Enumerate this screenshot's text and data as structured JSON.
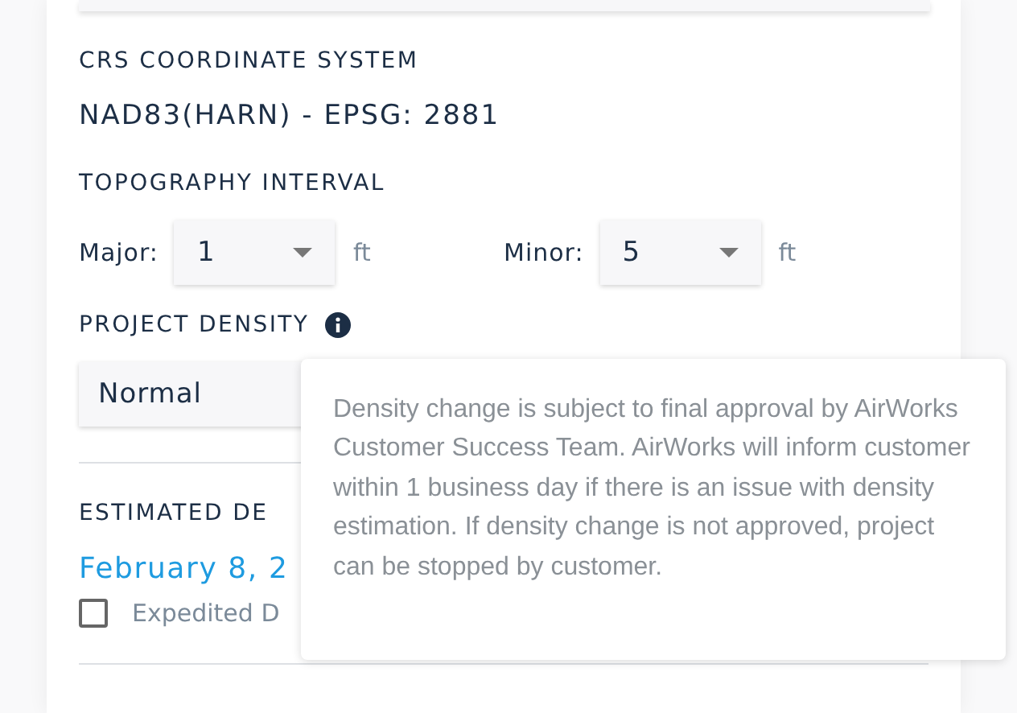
{
  "crs": {
    "label": "CRS COORDINATE SYSTEM",
    "value": "NAD83(HARN) - EPSG: 2881"
  },
  "topography": {
    "label": "TOPOGRAPHY INTERVAL",
    "fields": [
      {
        "label": "Major:",
        "value": "1",
        "unit": "ft"
      },
      {
        "label": "Minor:",
        "value": "5",
        "unit": "ft"
      }
    ]
  },
  "density": {
    "label": "PROJECT DENSITY",
    "value": "Normal"
  },
  "delivery": {
    "label": "ESTIMATED DE",
    "date": "February 8, 2",
    "expedited": {
      "label": "Expedited D",
      "checked": false
    }
  },
  "tooltip": {
    "text": "Density change is subject to final approval by AirWorks Customer Success Team. AirWorks will inform customer within 1 business day if there is an issue with density estimation. If density change is not approved, project can be stopped by customer."
  }
}
